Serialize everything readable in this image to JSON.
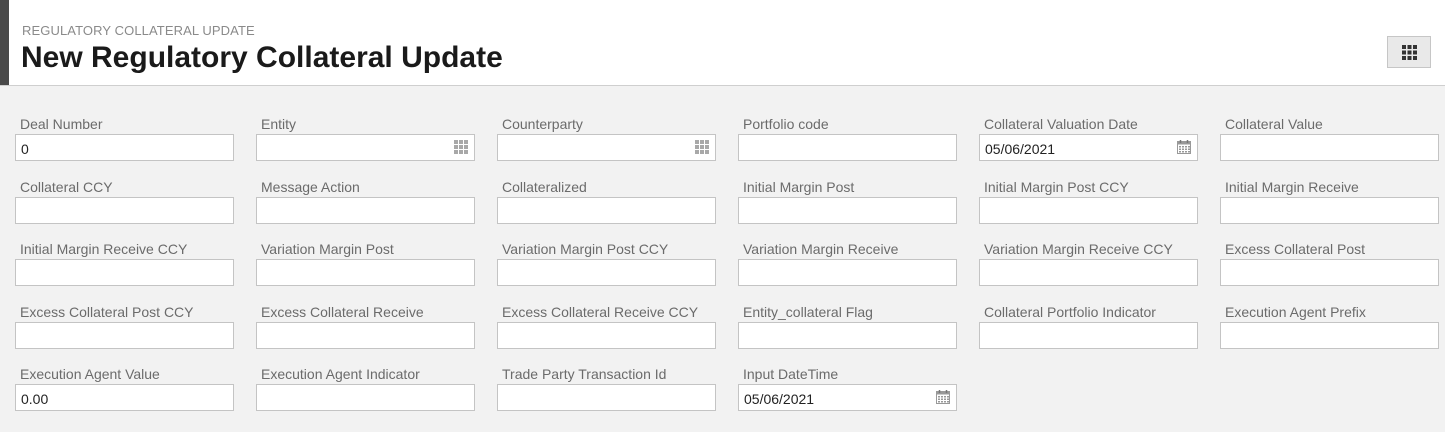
{
  "header": {
    "breadcrumb": "REGULATORY COLLATERAL UPDATE",
    "title": "New Regulatory Collateral Update",
    "action_icon": "grid-icon"
  },
  "colors": {
    "background": "#f2f2f2",
    "header_bar": "#4a4a4a",
    "label": "#6b6b6b",
    "border": "#c4c4c4"
  },
  "form": {
    "fields": [
      {
        "label": "Deal Number",
        "value": "0",
        "icon": null
      },
      {
        "label": "Entity",
        "value": "",
        "icon": "lookup-grid-icon"
      },
      {
        "label": "Counterparty",
        "value": "",
        "icon": "lookup-grid-icon"
      },
      {
        "label": "Portfolio code",
        "value": "",
        "icon": null
      },
      {
        "label": "Collateral Valuation Date",
        "value": "05/06/2021",
        "icon": "calendar-icon"
      },
      {
        "label": "Collateral Value",
        "value": "",
        "icon": null
      },
      {
        "label": "Collateral CCY",
        "value": "",
        "icon": null
      },
      {
        "label": "Message Action",
        "value": "",
        "icon": null
      },
      {
        "label": "Collateralized",
        "value": "",
        "icon": null
      },
      {
        "label": "Initial Margin Post",
        "value": "",
        "icon": null
      },
      {
        "label": "Initial Margin Post CCY",
        "value": "",
        "icon": null
      },
      {
        "label": "Initial Margin Receive",
        "value": "",
        "icon": null
      },
      {
        "label": "Initial Margin Receive CCY",
        "value": "",
        "icon": null
      },
      {
        "label": "Variation Margin Post",
        "value": "",
        "icon": null
      },
      {
        "label": "Variation Margin Post CCY",
        "value": "",
        "icon": null
      },
      {
        "label": "Variation Margin Receive",
        "value": "",
        "icon": null
      },
      {
        "label": "Variation Margin Receive CCY",
        "value": "",
        "icon": null
      },
      {
        "label": "Excess Collateral Post",
        "value": "",
        "icon": null
      },
      {
        "label": "Excess Collateral Post CCY",
        "value": "",
        "icon": null
      },
      {
        "label": "Excess Collateral Receive",
        "value": "",
        "icon": null
      },
      {
        "label": "Excess Collateral Receive CCY",
        "value": "",
        "icon": null
      },
      {
        "label": "Entity_collateral Flag",
        "value": "",
        "icon": null
      },
      {
        "label": "Collateral Portfolio Indicator",
        "value": "",
        "icon": null
      },
      {
        "label": "Execution Agent Prefix",
        "value": "",
        "icon": null
      },
      {
        "label": "Execution Agent Value",
        "value": "0.00",
        "icon": null
      },
      {
        "label": "Execution Agent Indicator",
        "value": "",
        "icon": null
      },
      {
        "label": "Trade Party Transaction Id",
        "value": "",
        "icon": null
      },
      {
        "label": "Input DateTime",
        "value": "05/06/2021",
        "icon": "calendar-icon"
      }
    ]
  }
}
